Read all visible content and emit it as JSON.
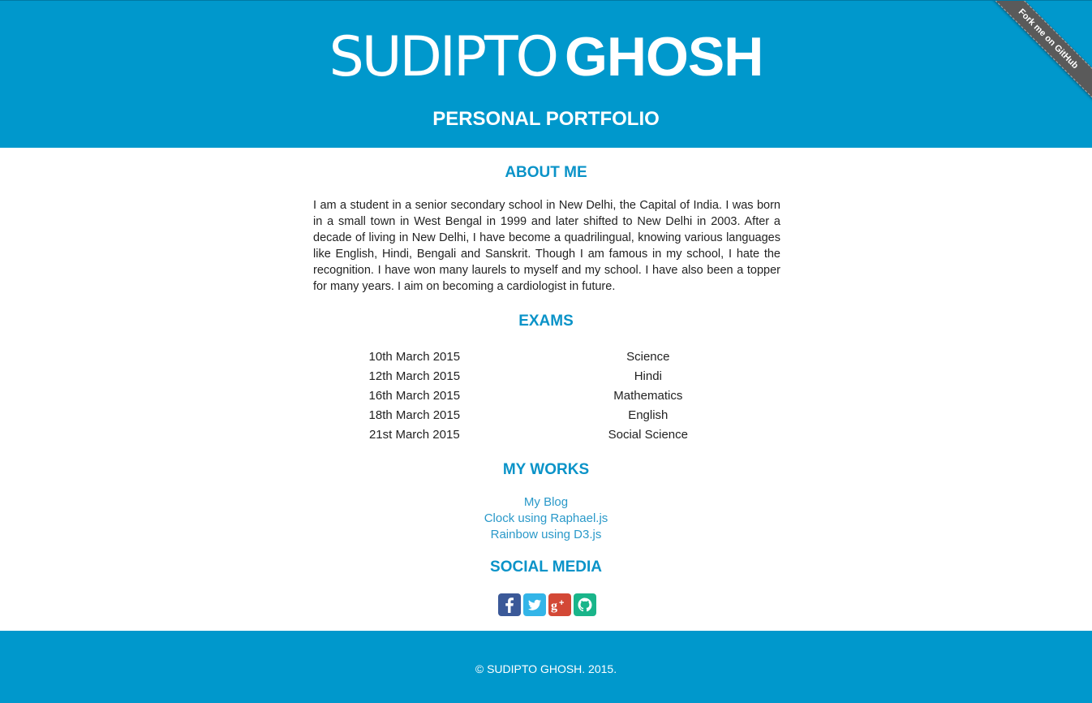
{
  "header": {
    "name_first": "SUDIPTO",
    "name_last": "GHOSH",
    "tagline": "PERSONAL PORTFOLIO",
    "ribbon_label": "Fork me on GitHub"
  },
  "about": {
    "title": "ABOUT ME",
    "text": "I am a student in a senior secondary school in New Delhi, the Capital of India. I was born in a small town in West Bengal in 1999 and later shifted to New Delhi in 2003. After a decade of living in New Delhi, I have become a quadrilingual, knowing various languages like English, Hindi, Bengali and Sanskrit. Though I am famous in my school, I hate the recognition. I have won many laurels to myself and my school. I have also been a topper for many years. I aim on becoming a cardiologist in future."
  },
  "exams": {
    "title": "EXAMS",
    "rows": [
      {
        "date": "10th March 2015",
        "subject": "Science"
      },
      {
        "date": "12th March 2015",
        "subject": "Hindi"
      },
      {
        "date": "16th March 2015",
        "subject": "Mathematics"
      },
      {
        "date": "18th March 2015",
        "subject": "English"
      },
      {
        "date": "21st March 2015",
        "subject": "Social Science"
      }
    ]
  },
  "works": {
    "title": "MY WORKS",
    "links": [
      "My Blog",
      "Clock using Raphael.js",
      "Rainbow using D3.js"
    ]
  },
  "social": {
    "title": "SOCIAL MEDIA",
    "icons": [
      {
        "name": "facebook-icon",
        "color": "#3b5998"
      },
      {
        "name": "twitter-icon",
        "color": "#33b5e8"
      },
      {
        "name": "google-plus-icon",
        "color": "#d34836"
      },
      {
        "name": "github-icon",
        "color": "#1ab58a"
      }
    ]
  },
  "footer": {
    "copyright": "© SUDIPTO GHOSH. 2015."
  },
  "colors": {
    "brand_blue": "#0098cc",
    "heading_blue": "#0a93c8",
    "link_blue": "#2a99c9"
  }
}
